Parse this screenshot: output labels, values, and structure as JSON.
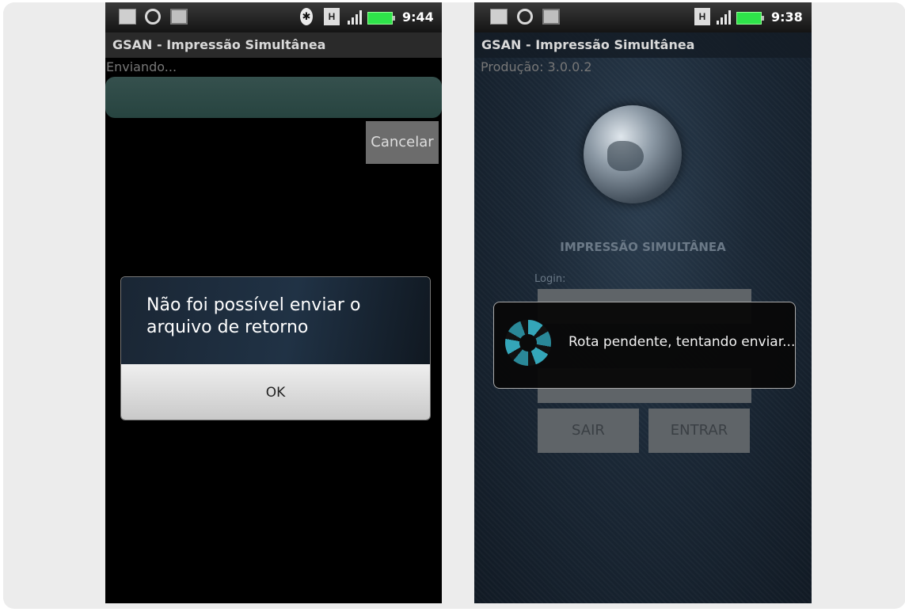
{
  "left_screen": {
    "status_bar": {
      "time": "9:44",
      "network_icon": "H"
    },
    "title": "GSAN - Impressão Simultânea",
    "status_text": "Enviando...",
    "cancel_label": "Cancelar",
    "dialog": {
      "message": "Não foi possível enviar o arquivo de retorno",
      "ok_label": "OK"
    }
  },
  "right_screen": {
    "status_bar": {
      "time": "9:38",
      "network_icon": "H"
    },
    "title": "GSAN - Impressão Simultânea",
    "version_text": "Produção: 3.0.0.2",
    "app_name": "IMPRESSÃO SIMULTÂNEA",
    "login_label": "Login:",
    "exit_label": "SAIR",
    "enter_label": "ENTRAR",
    "toast_message": "Rota pendente, tentando enviar..."
  },
  "colors": {
    "battery": "#2ee34a",
    "progress": "#35504d",
    "spinner": "#34a6b9"
  }
}
